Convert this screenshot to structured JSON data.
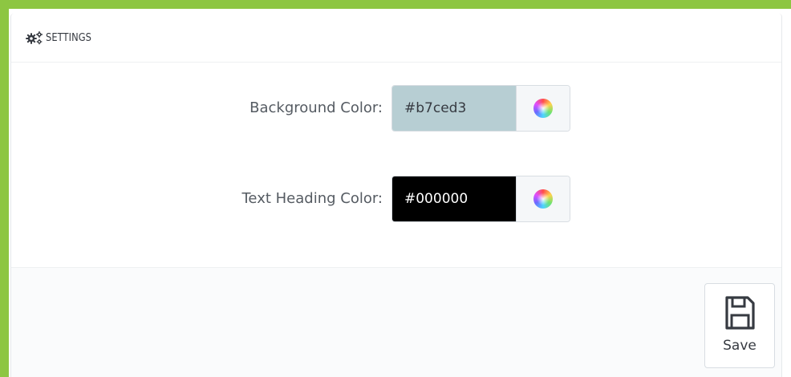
{
  "panel": {
    "title": "SETTINGS",
    "icon": "cogs-icon"
  },
  "fields": {
    "background_color": {
      "label": "Background Color:",
      "value": "#b7ced3",
      "swatch": "#b7ced3",
      "text_color": "#363a41",
      "picker_icon": "color-wheel-icon"
    },
    "text_heading_color": {
      "label": "Text Heading Color:",
      "value": "#000000",
      "swatch": "#000000",
      "text_color": "#ffffff",
      "picker_icon": "color-wheel-icon"
    }
  },
  "footer": {
    "save_label": "Save",
    "save_icon": "floppy-disk-icon"
  },
  "colors": {
    "frame_accent": "#8dc642"
  }
}
